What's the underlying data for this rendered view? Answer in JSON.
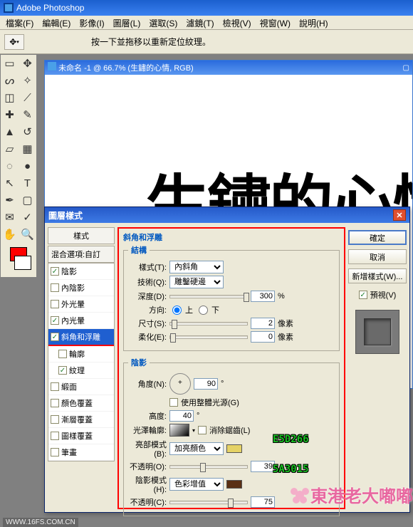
{
  "app": {
    "title": "Adobe Photoshop"
  },
  "menu": [
    "檔案(F)",
    "編輯(E)",
    "影像(I)",
    "圖層(L)",
    "選取(S)",
    "濾鏡(T)",
    "檢視(V)",
    "視窗(W)",
    "說明(H)"
  ],
  "toolbar": {
    "hint": "按一下並拖移以重新定位紋理。"
  },
  "doc": {
    "title": "未命名 -1 @ 66.7% (生鏽的心情, RGB)",
    "canvas_text": "生鏽的心情"
  },
  "palette": {
    "fg": "#ff0000",
    "bg": "#ffffff"
  },
  "dialog": {
    "title": "圖層樣式",
    "styles_header": "樣式",
    "blend_header": "混合選項:自訂",
    "style_items": [
      {
        "label": "陰影",
        "checked": true
      },
      {
        "label": "內陰影",
        "checked": false
      },
      {
        "label": "外光暈",
        "checked": false
      },
      {
        "label": "內光暈",
        "checked": true
      },
      {
        "label": "斜角和浮雕",
        "checked": true,
        "selected": true
      },
      {
        "label": "輪廓",
        "checked": false,
        "indent": true
      },
      {
        "label": "紋理",
        "checked": true,
        "indent": true
      },
      {
        "label": "緞面",
        "checked": false
      },
      {
        "label": "顏色覆蓋",
        "checked": false
      },
      {
        "label": "漸層覆蓋",
        "checked": false
      },
      {
        "label": "圖樣覆蓋",
        "checked": false
      },
      {
        "label": "筆畫",
        "checked": false
      }
    ],
    "panel_title": "斜角和浮雕",
    "structure": {
      "title": "結構",
      "style_label": "樣式(T):",
      "style_value": "內斜角",
      "technique_label": "技術(Q):",
      "technique_value": "雕鑿硬邊",
      "depth_label": "深度(D):",
      "depth_value": "300",
      "depth_unit": "%",
      "direction_label": "方向:",
      "up": "上",
      "down": "下",
      "direction_selected": "up",
      "size_label": "尺寸(S):",
      "size_value": "2",
      "size_unit": "像素",
      "soften_label": "柔化(E):",
      "soften_value": "0",
      "soften_unit": "像素"
    },
    "shading": {
      "title": "陰影",
      "angle_label": "角度(N):",
      "angle_value": "90",
      "angle_unit": "°",
      "global_light_label": "使用整體光源(G)",
      "global_light_checked": false,
      "altitude_label": "高度:",
      "altitude_value": "40",
      "altitude_unit": "°",
      "gloss_label": "光澤輪廓:",
      "antialias_label": "消除鋸齒(L)",
      "antialias_checked": false,
      "hl_mode_label": "亮部模式(B):",
      "hl_mode_value": "加亮顏色",
      "hl_color": "#E5D266",
      "hl_hex": "E5D266",
      "hl_opacity_label": "不透明(O):",
      "hl_opacity_value": "39",
      "sh_mode_label": "陰影模式(H):",
      "sh_mode_value": "色彩增值",
      "sh_color": "#5A3015",
      "sh_hex": "5A3015",
      "sh_opacity_label": "不透明(C):",
      "sh_opacity_value": "75"
    },
    "actions": {
      "ok": "確定",
      "cancel": "取消",
      "new_style": "新增樣式(W)...",
      "preview_label": "預視(V)",
      "preview_checked": true
    }
  },
  "watermark": "東港老大嘟嘟",
  "footer": "WWW.16FS.COM.CN"
}
